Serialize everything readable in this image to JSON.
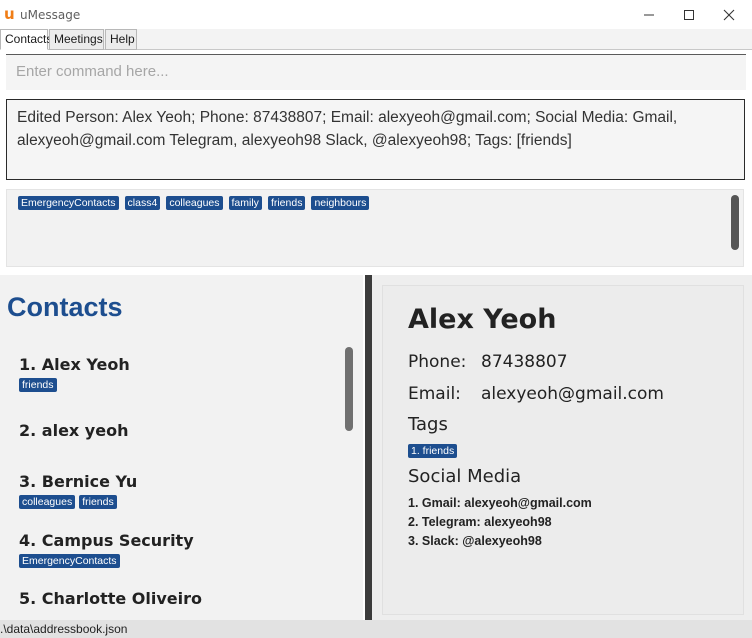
{
  "window": {
    "title": "uMessage",
    "logo": "u"
  },
  "menu": {
    "items": [
      "Contacts",
      "Meetings",
      "Help"
    ]
  },
  "command": {
    "placeholder": "Enter command here..."
  },
  "result": {
    "text": "Edited Person: Alex Yeoh; Phone: 87438807; Email: alexyeoh@gmail.com; Social Media: Gmail, alexyeoh@gmail.com Telegram, alexyeoh98 Slack, @alexyeoh98; Tags: [friends]"
  },
  "tag_list": [
    "EmergencyContacts",
    "class4",
    "colleagues",
    "family",
    "friends",
    "neighbours"
  ],
  "contacts": {
    "title": "Contacts",
    "items": [
      {
        "label": "1.  Alex Yeoh",
        "tags": [
          "friends"
        ]
      },
      {
        "label": "2.  alex yeoh",
        "tags": []
      },
      {
        "label": "3.  Bernice Yu",
        "tags": [
          "colleagues",
          "friends"
        ]
      },
      {
        "label": "4.  Campus Security",
        "tags": [
          "EmergencyContacts"
        ]
      },
      {
        "label": "5.  Charlotte Oliveiro",
        "tags": []
      }
    ]
  },
  "detail": {
    "name": "Alex Yeoh",
    "phone_label": "Phone:",
    "phone": "87438807",
    "email_label": "Email:",
    "email": "alexyeoh@gmail.com",
    "tags_title": "Tags",
    "tags": [
      "1. friends"
    ],
    "social_title": "Social Media",
    "social": [
      "1. Gmail: alexyeoh@gmail.com",
      "2. Telegram: alexyeoh98",
      "3. Slack: @alexyeoh98"
    ]
  },
  "status": {
    "path": ".\\data\\addressbook.json"
  },
  "colors": {
    "accent": "#1d4e8f",
    "logo": "#f07d16",
    "divider": "#3c3c3c"
  }
}
